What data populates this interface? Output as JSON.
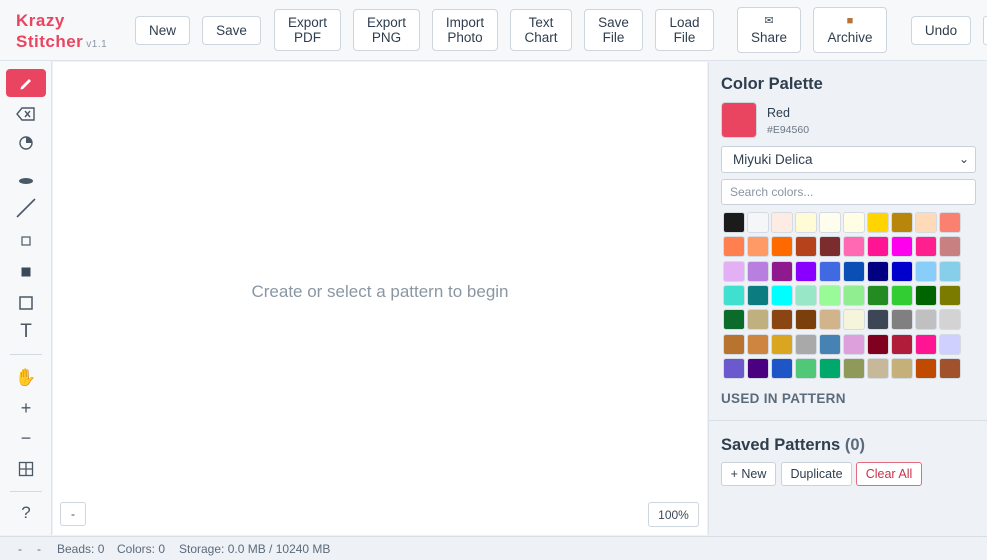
{
  "app": {
    "name_line1": "Krazy",
    "name_line2": "Stitcher",
    "version": "v1.1"
  },
  "header": {
    "buttons": [
      {
        "id": "new",
        "line1": "New",
        "line2": ""
      },
      {
        "id": "save",
        "line1": "Save",
        "line2": ""
      },
      {
        "id": "export-pdf",
        "line1": "Export",
        "line2": "PDF"
      },
      {
        "id": "export-png",
        "line1": "Export",
        "line2": "PNG"
      },
      {
        "id": "import-photo",
        "line1": "Import",
        "line2": "Photo"
      },
      {
        "id": "text-chart",
        "line1": "Text",
        "line2": "Chart"
      },
      {
        "id": "save-file",
        "line1": "Save",
        "line2": "File"
      },
      {
        "id": "load-file",
        "line1": "Load",
        "line2": "File"
      }
    ],
    "share": {
      "icon": "envelope-icon",
      "label": "Share"
    },
    "archive": {
      "icon": "box-icon",
      "label": "Archive"
    },
    "undo": "Undo"
  },
  "toolbar": {
    "tools": [
      {
        "name": "pencil-tool",
        "icon": "pencil-icon",
        "active": true
      },
      {
        "name": "eraser-tool",
        "icon": "eraser-icon",
        "active": false
      },
      {
        "name": "fill-tool",
        "icon": "fill-icon",
        "active": false
      },
      {
        "name": "bead-tool",
        "icon": "bead-icon",
        "active": false
      },
      {
        "name": "line-tool",
        "icon": "line-icon",
        "active": false
      },
      {
        "name": "small-square-tool",
        "icon": "small-square-icon",
        "active": false
      },
      {
        "name": "filled-square-tool",
        "icon": "filled-square-icon",
        "active": false
      },
      {
        "name": "rectangle-tool",
        "icon": "rectangle-icon",
        "active": false
      },
      {
        "name": "text-tool",
        "icon": "text-icon",
        "active": false
      },
      {
        "name": "pan-tool",
        "icon": "hand-icon",
        "active": false
      },
      {
        "name": "zoom-in-tool",
        "icon": "plus-icon",
        "active": false
      },
      {
        "name": "zoom-out-tool",
        "icon": "minus-icon",
        "active": false
      },
      {
        "name": "grid-toggle",
        "icon": "grid-icon",
        "active": false
      },
      {
        "name": "help-tool",
        "icon": "help-icon",
        "active": false
      }
    ]
  },
  "canvas": {
    "placeholder": "Create or select a pattern to begin",
    "minimize_label": "-",
    "zoom": "100%"
  },
  "palette": {
    "title": "Color Palette",
    "selected": {
      "name": "Red",
      "hex": "#E94560"
    },
    "brand": "Miyuki Delica",
    "search_placeholder": "Search colors...",
    "swatches": [
      [
        "#1b1b1b",
        "#f5f6f8",
        "#fdebe4",
        "#fffbd6",
        "#fffdee",
        "#fffde4",
        "#ffd400",
        "#b8860b",
        "#ffdab9",
        "#fa8072"
      ],
      [
        "#ff7f50",
        "#ff9966",
        "#ff6a00",
        "#b5421a",
        "#7b2d2d",
        "#ff69b4",
        "#ff1493",
        "#ff00ee",
        "#ff1f8f",
        "#c98080"
      ],
      [
        "#e3b0f5",
        "#b97fe0",
        "#8e1a8e",
        "#8a00ff",
        "#4169e1",
        "#0a4fb5",
        "#000080",
        "#0000cd",
        "#87cefa",
        "#87ceeb"
      ],
      [
        "#40e0d0",
        "#0b7c80",
        "#00ffff",
        "#98e8c8",
        "#98fb98",
        "#90ee90",
        "#228b22",
        "#32cd32",
        "#006400",
        "#7b7b00"
      ],
      [
        "#0a6b2a",
        "#c0b080",
        "#8b4513",
        "#7a3f0a",
        "#d2b48c",
        "#f5f5dc",
        "#3c4654",
        "#808080",
        "#c0c0c0",
        "#d3d3d3"
      ],
      [
        "#b8732f",
        "#cd853f",
        "#daa520",
        "#a9a9a9",
        "#4682b4",
        "#dda0dd",
        "#800020",
        "#b01c3a",
        "#ff1493",
        "#d0d0ff"
      ],
      [
        "#6a5acd",
        "#4b0082",
        "#1e56c8",
        "#50c878",
        "#00a86b",
        "#8f9a5a",
        "#c8b89a",
        "#c5b07a",
        "#c04a00",
        "#a0522d"
      ]
    ],
    "used_label": "USED IN PATTERN"
  },
  "saved": {
    "title": "Saved Patterns",
    "count": "(0)",
    "new_label": "+ New",
    "duplicate_label": "Duplicate",
    "clear_label": "Clear All"
  },
  "status": {
    "dash1": "-",
    "dash2": "-",
    "beads": "Beads: 0",
    "colors": "Colors: 0",
    "storage": "Storage: 0.0 MB / 10240 MB"
  }
}
